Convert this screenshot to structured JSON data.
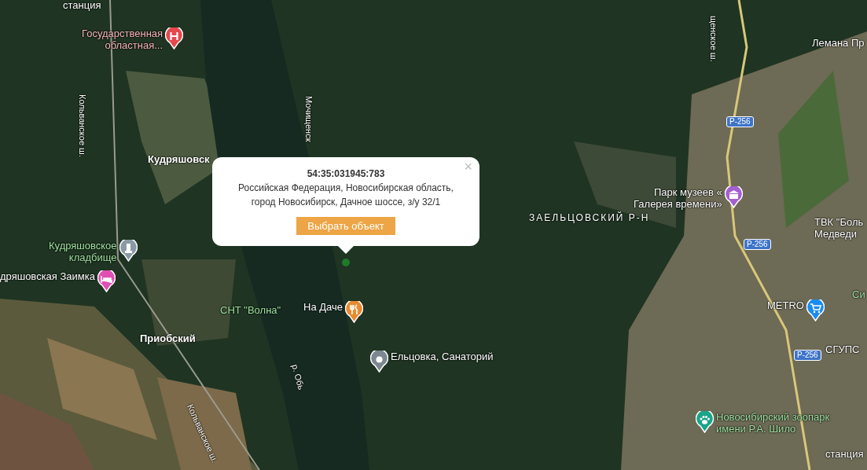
{
  "map": {
    "labels": [
      {
        "kind": "station",
        "lines": [
          "станция"
        ]
      },
      {
        "kind": "hospital",
        "lines": [
          "Государственная",
          "областная..."
        ]
      },
      {
        "kind": "road",
        "lines": [
          "Кольванское ш."
        ]
      },
      {
        "kind": "road",
        "lines": [
          "Мочищенск"
        ]
      },
      {
        "kind": "settlement",
        "lines": [
          "Кудряшовск"
        ]
      },
      {
        "kind": "cemetery",
        "lines": [
          "Кудряшовское",
          "кладбище"
        ]
      },
      {
        "kind": "hotel",
        "lines": [
          "дряшовская Заимка"
        ]
      },
      {
        "kind": "settlement",
        "lines": [
          "Приобский"
        ]
      },
      {
        "kind": "road",
        "lines": [
          "Кольванское ш."
        ]
      },
      {
        "kind": "area",
        "lines": [
          "СНТ \"Волна\""
        ]
      },
      {
        "kind": "restaurant",
        "lines": [
          "На Даче"
        ]
      },
      {
        "kind": "river",
        "lines": [
          "р. Обь"
        ]
      },
      {
        "kind": "landmark",
        "lines": [
          "Ельцовка, Санаторий"
        ]
      },
      {
        "kind": "district",
        "lines": [
          "ЗАЕЛЬЦОВСКИЙ Р-Н"
        ]
      },
      {
        "kind": "museum",
        "lines": [
          "Парк музеев «",
          "Галерея времени»"
        ]
      },
      {
        "kind": "business",
        "lines": [
          "Лемана Пр"
        ]
      },
      {
        "kind": "road",
        "lines": [
          "щенское ш."
        ]
      },
      {
        "kind": "route",
        "lines": [
          "Р-256"
        ]
      },
      {
        "kind": "route",
        "lines": [
          "Р-256"
        ]
      },
      {
        "kind": "route",
        "lines": [
          "Р-256"
        ]
      },
      {
        "kind": "business",
        "lines": [
          "ТВК \"Боль",
          "Медведи"
        ]
      },
      {
        "kind": "store",
        "lines": [
          "METRO"
        ]
      },
      {
        "kind": "area",
        "lines": [
          "Си"
        ]
      },
      {
        "kind": "business",
        "lines": [
          "СГУПС"
        ]
      },
      {
        "kind": "zoo",
        "lines": [
          "Новосибирский зоопарк",
          "имени Р.А. Шило"
        ]
      },
      {
        "kind": "station",
        "lines": [
          "станция"
        ]
      }
    ]
  },
  "popup": {
    "title": "54:35:031945:783",
    "address": "Российская Федерация, Новосибирская область, город Новосибирск, Дачное шоссе, з/у 32/1",
    "button": "Выбрать объект",
    "close": "×"
  }
}
